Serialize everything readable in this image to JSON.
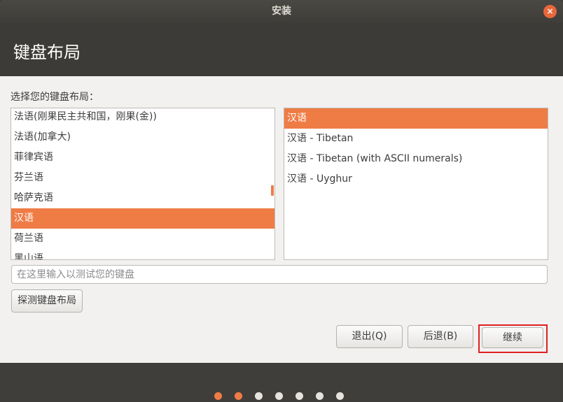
{
  "window": {
    "title": "安装",
    "close_icon": "×"
  },
  "header": {
    "title": "键盘布局"
  },
  "prompt": "选择您的键盘布局：",
  "layout_list": {
    "items": [
      {
        "label": "法语(刚果民主共和国，刚果(金))",
        "selected": false
      },
      {
        "label": "法语(加拿大)",
        "selected": false
      },
      {
        "label": "菲律宾语",
        "selected": false
      },
      {
        "label": "芬兰语",
        "selected": false
      },
      {
        "label": "哈萨克语",
        "selected": false
      },
      {
        "label": "汉语",
        "selected": true
      },
      {
        "label": "荷兰语",
        "selected": false
      },
      {
        "label": "黑山语",
        "selected": false
      }
    ]
  },
  "variant_list": {
    "items": [
      {
        "label": "汉语",
        "selected": true
      },
      {
        "label": "汉语 - Tibetan",
        "selected": false
      },
      {
        "label": "汉语 - Tibetan (with ASCII numerals)",
        "selected": false
      },
      {
        "label": "汉语 - Uyghur",
        "selected": false
      }
    ]
  },
  "test_input": {
    "placeholder": "在这里输入以测试您的键盘",
    "value": ""
  },
  "buttons": {
    "detect": "探测键盘布局",
    "quit": "退出(Q)",
    "back": "后退(B)",
    "continue": "继续"
  },
  "progress": {
    "total_steps": 7,
    "current_step": 2
  },
  "colors": {
    "accent": "#ef7c45",
    "highlight_box": "#e02020"
  }
}
